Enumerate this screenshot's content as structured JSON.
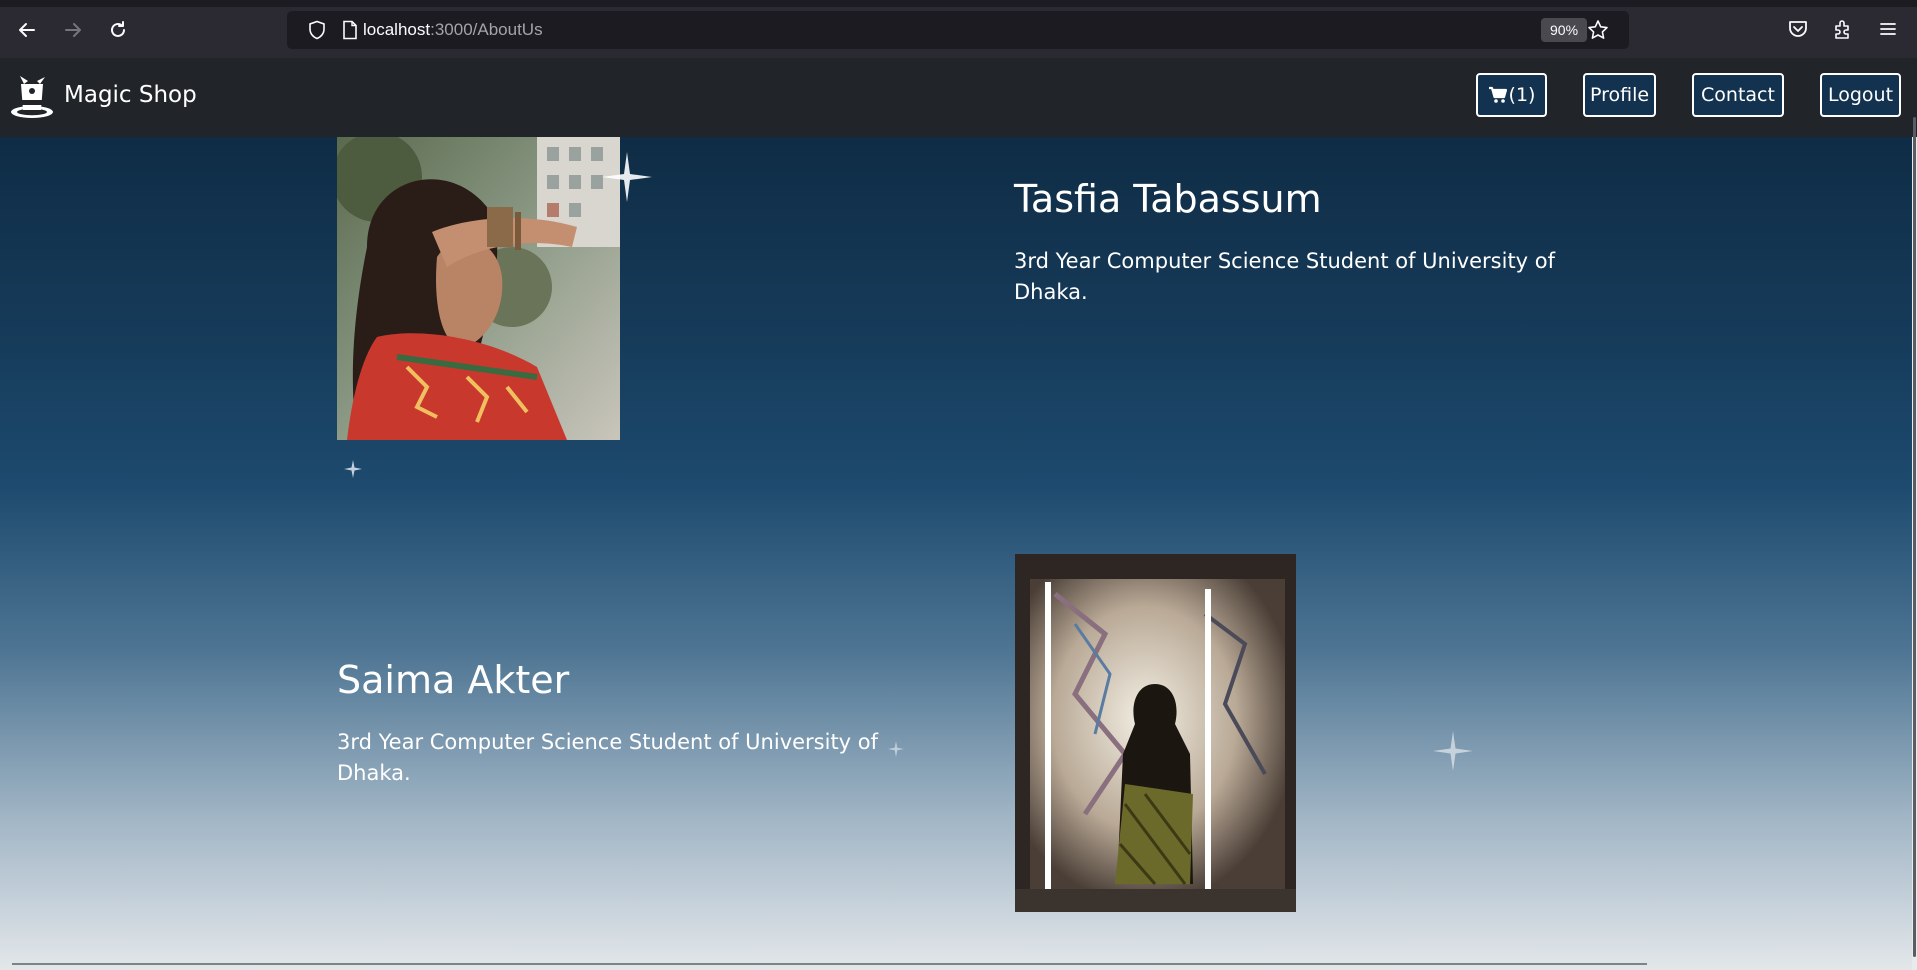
{
  "browser": {
    "url_host": "localhost",
    "url_path": ":3000/AboutUs",
    "zoom": "90%",
    "icons": [
      "back-arrow-icon",
      "forward-arrow-icon",
      "reload-icon",
      "shield-icon",
      "page-icon",
      "bookmark-star-icon",
      "pocket-icon",
      "extensions-icon",
      "menu-icon"
    ]
  },
  "navbar": {
    "brand": "Magic Shop",
    "brand_icon": "magic-hat-icon",
    "cart_count": "(1)",
    "cart_icon": "cart-icon",
    "profile": "Profile",
    "contact": "Contact",
    "logout": "Logout"
  },
  "team": [
    {
      "name": "Tasfia Tabassum",
      "description": "3rd Year Computer Science Student of University of Dhaka."
    },
    {
      "name": "Saima Akter",
      "description": "3rd Year Computer Science Student of University of Dhaka."
    }
  ],
  "colors": {
    "navbar_bg": "#212529",
    "button_border": "#ffffff",
    "gradient_top": "#0f2c45",
    "gradient_bottom": "#e3e7ea"
  }
}
